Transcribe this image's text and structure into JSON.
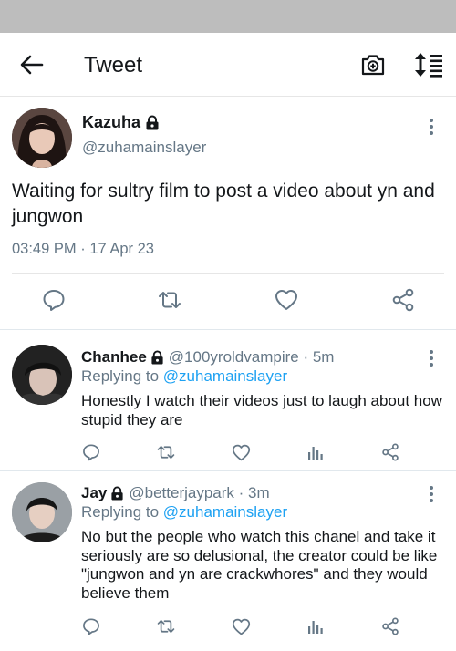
{
  "header": {
    "title": "Tweet",
    "back_icon": "arrow-left-icon",
    "camera_icon": "camera-add-icon",
    "sort_icon": "sort-list-icon"
  },
  "main_tweet": {
    "author_name": "Kazuha",
    "author_handle": "@zuhamainslayer",
    "protected": true,
    "text": "Waiting for sultry film to post a video about yn and jungwon",
    "time": "03:49 PM",
    "date": "17 Apr 23",
    "time_separator": "·"
  },
  "replies": [
    {
      "author_name": "Chanhee",
      "author_handle": "@100yroldvampire",
      "protected": true,
      "age": "5m",
      "replying_label": "Replying to",
      "replying_to": "@zuhamainslayer",
      "text": "Honestly I watch their videos just to laugh about how stupid they are"
    },
    {
      "author_name": "Jay",
      "author_handle": "@betterjaypark",
      "protected": true,
      "age": "3m",
      "replying_label": "Replying to",
      "replying_to": "@zuhamainslayer",
      "text": "No but the people who watch this chanel and take it seriously are so delusional, the creator could be like \"jungwon and yn are crackwhores\" and they would believe them"
    }
  ],
  "colors": {
    "accent": "#1da1f2",
    "secondary_text": "#657786",
    "icon": "#657786",
    "status_bar": "#bdbdbd"
  }
}
